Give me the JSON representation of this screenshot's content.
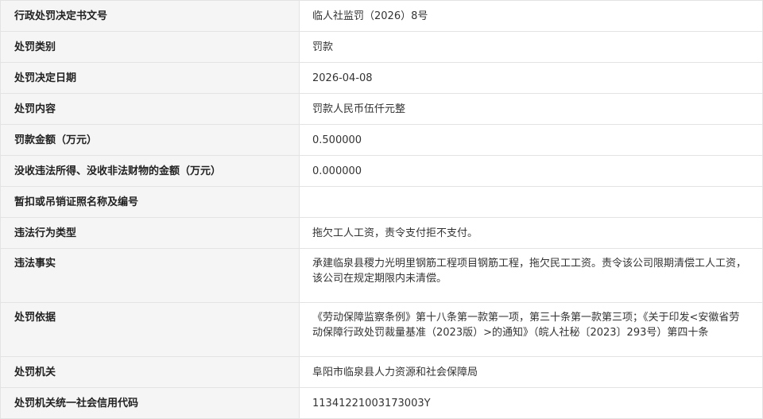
{
  "rows": [
    {
      "label": "行政处罚决定书文号",
      "value": "临人社监罚（2026）8号"
    },
    {
      "label": "处罚类别",
      "value": "罚款"
    },
    {
      "label": "处罚决定日期",
      "value": "2026-04-08"
    },
    {
      "label": "处罚内容",
      "value": "罚款人民币伍仟元整"
    },
    {
      "label": "罚款金额（万元）",
      "value": "0.500000"
    },
    {
      "label": "没收违法所得、没收非法财物的金额（万元）",
      "value": "0.000000"
    },
    {
      "label": "暂扣或吊销证照名称及编号",
      "value": ""
    },
    {
      "label": "违法行为类型",
      "value": "拖欠工人工资，责令支付拒不支付。"
    },
    {
      "label": "违法事实",
      "value": "承建临泉县稷力光明里钢筋工程项目钢筋工程，拖欠民工工资。责令该公司限期清偿工人工资，该公司在规定期限内未清偿。"
    },
    {
      "label": "处罚依据",
      "value": "《劳动保障监察条例》第十八条第一款第一项，第三十条第一款第三项；《关于印发<安徽省劳动保障行政处罚裁量基准（2023版）>的通知》（皖人社秘〔2023〕293号）第四十条"
    },
    {
      "label": "处罚机关",
      "value": "阜阳市临泉县人力资源和社会保障局"
    },
    {
      "label": "处罚机关统一社会信用代码",
      "value": "11341221003173003Y"
    }
  ]
}
